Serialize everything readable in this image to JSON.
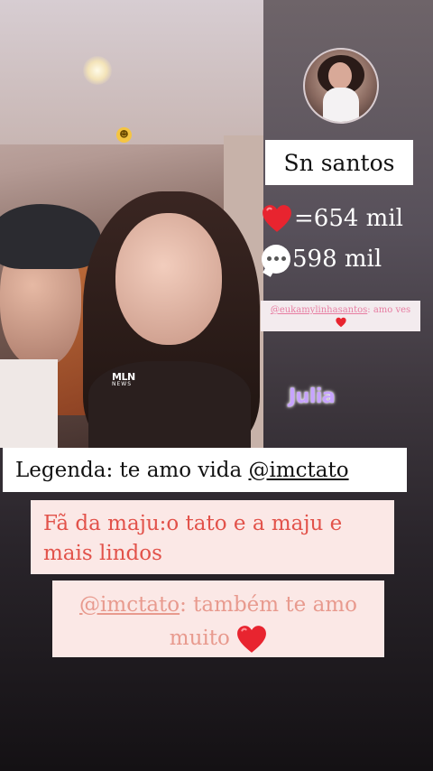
{
  "profile": {
    "name": "Sn santos"
  },
  "stats": {
    "likes": "=654 mil",
    "comments": "598 mil"
  },
  "small_comment": {
    "user": "@eukamylinhasantos",
    "text": ": amo ves"
  },
  "overlay_label": "Julia",
  "watermark": {
    "top": "MLN",
    "bottom": "NEWS"
  },
  "caption": {
    "prefix": "Legenda: te amo vida ",
    "mention": "@imctato"
  },
  "fan_comment": {
    "text": "Fã da maju:o tato e a maju e mais lindos"
  },
  "reply": {
    "user": "@imctato",
    "text": ": também te amo muito"
  },
  "colors": {
    "heart": "#e8242f",
    "julia_text": "#c7a4ff",
    "fan_text": "#e2524a",
    "reply_text": "#e89a8e",
    "small_comment_text": "#e77da2"
  },
  "icons": [
    "heart-icon",
    "comment-bubble-icon",
    "smiley-emoji-icon"
  ]
}
